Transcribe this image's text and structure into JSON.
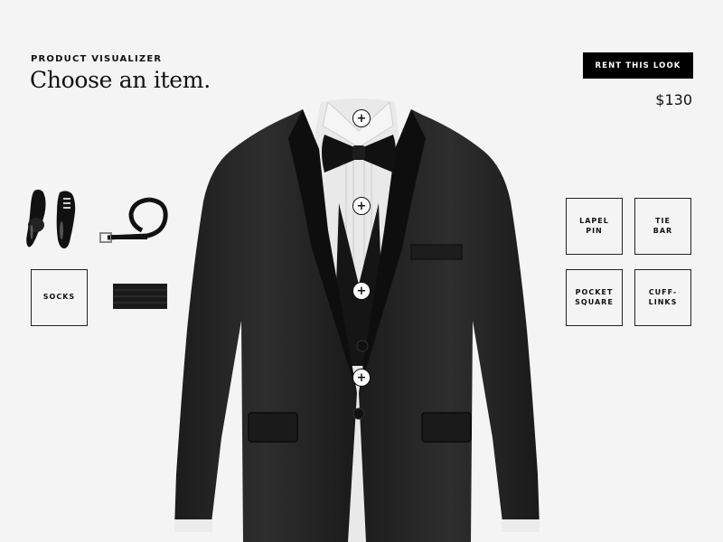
{
  "header": {
    "eyebrow": "PRODUCT VISUALIZER",
    "title": "Choose an item.",
    "rent_label": "RENT THIS LOOK",
    "price": "$130"
  },
  "left_items": {
    "socks_label": "SOCKS"
  },
  "right_items": {
    "lapel_pin_label": "LAPEL PIN",
    "tie_bar_label": "TIE\nBAR",
    "pocket_square_label": "POCKET\nSQUARE",
    "cufflinks_label": "CUFF- LINKS"
  },
  "hotspots": [
    "+",
    "+",
    "+",
    "+"
  ],
  "icons": {
    "shoes": "shoes-icon",
    "belt": "belt-icon",
    "cummerbund": "cummerbund-icon",
    "hotspot": "plus-icon"
  },
  "colors": {
    "background": "#f4f4f4",
    "button": "#000000",
    "border": "#222222"
  }
}
